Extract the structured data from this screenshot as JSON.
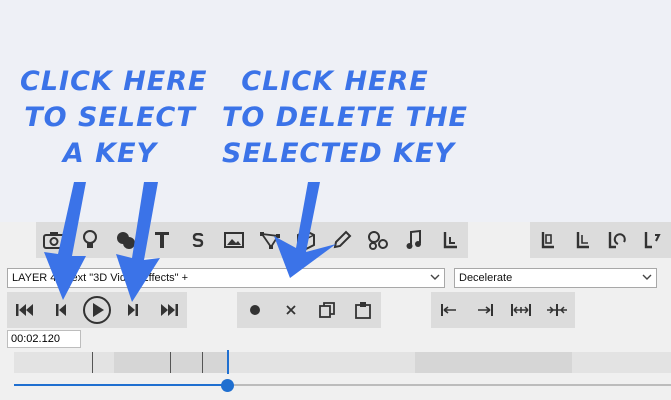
{
  "callouts": {
    "select_key": [
      "CLICK HERE",
      "TO SELECT",
      "A KEY"
    ],
    "delete_key": [
      "CLICK HERE",
      "TO DELETE THE",
      "SELECTED KEY"
    ]
  },
  "toolbar": {
    "tools": [
      "camera-icon",
      "light-bulb-icon",
      "paint-icon",
      "text-icon",
      "s-icon",
      "image-icon",
      "path-icon",
      "cube-icon",
      "pen-icon",
      "shapes-icon",
      "music-icon",
      "corner-icon"
    ],
    "right_tools": [
      "layout-corner-a-icon",
      "layout-corner-b-icon",
      "layout-corner-c-icon",
      "layout-corner-d-icon"
    ]
  },
  "layer_select": {
    "value": "LAYER 4 - Text \"3D Video Effects\" +"
  },
  "easing_select": {
    "value": "Decelerate"
  },
  "transport": [
    "skip-to-start-icon",
    "previous-key-icon",
    "play-icon",
    "next-key-icon",
    "skip-to-end-icon"
  ],
  "key_tools": [
    "add-key-icon",
    "delete-key-icon",
    "copy-key-icon",
    "paste-key-icon"
  ],
  "align_tools": [
    "align-left-icon",
    "align-right-icon",
    "spread-icon",
    "collapse-icon"
  ],
  "time": {
    "value": "00:02.120"
  },
  "timeline": {
    "progress_fraction": 0.33
  },
  "colors": {
    "callout": "#3b73e8",
    "accent": "#1f6fd0"
  }
}
